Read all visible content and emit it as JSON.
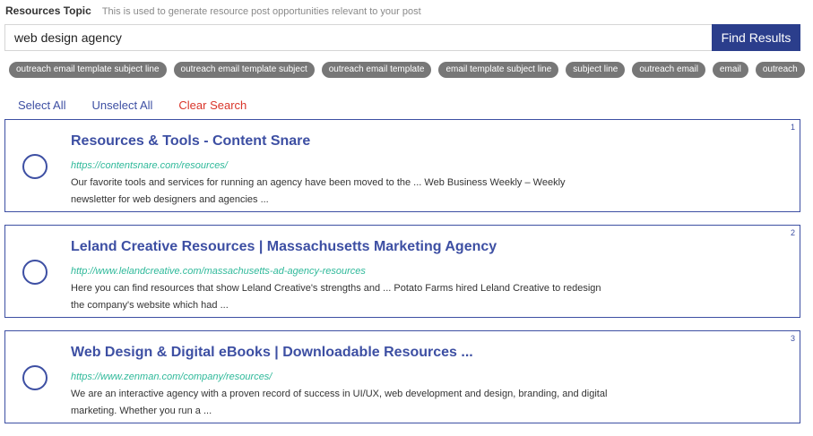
{
  "topic": {
    "label": "Resources Topic",
    "help": "This is used to generate resource post opportunities relevant to your post"
  },
  "search": {
    "value": "web design agency",
    "button_label": "Find Results"
  },
  "chips": [
    "outreach email template subject line",
    "outreach email template subject",
    "outreach email template",
    "email template subject line",
    "subject line",
    "outreach email",
    "email",
    "outreach"
  ],
  "actions": {
    "select_all": "Select All",
    "unselect_all": "Unselect All",
    "clear_search": "Clear Search"
  },
  "results": [
    {
      "num": "1",
      "title": "Resources & Tools - Content Snare",
      "url": "https://contentsnare.com/resources/",
      "desc": "Our favorite tools and services for running an agency have been moved to the ... Web Business Weekly – Weekly newsletter for web designers and agencies ..."
    },
    {
      "num": "2",
      "title": "Leland Creative Resources | Massachusetts Marketing Agency",
      "url": "http://www.lelandcreative.com/massachusetts-ad-agency-resources",
      "desc": "Here you can find resources that show Leland Creative's strengths and ... Potato Farms hired Leland Creative to redesign the company's website which had ..."
    },
    {
      "num": "3",
      "title": "Web Design & Digital eBooks | Downloadable Resources ...",
      "url": "https://www.zenman.com/company/resources/",
      "desc": "We are an interactive agency with a proven record of success in UI/UX, web development and design, branding, and digital marketing. Whether you run a ..."
    }
  ]
}
